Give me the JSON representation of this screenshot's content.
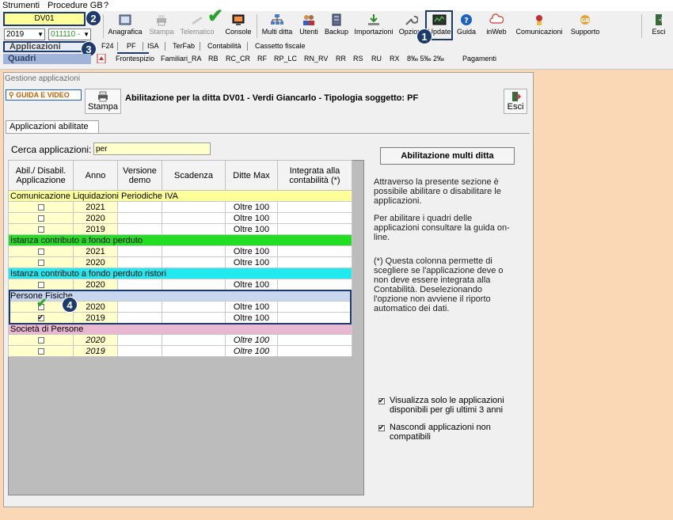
{
  "menubar": {
    "items": [
      "Strumenti",
      "Procedure GB",
      "?"
    ]
  },
  "context": {
    "firm": "DV01",
    "year": "2019",
    "code": "011110 -"
  },
  "callouts": [
    "1",
    "2",
    "3",
    "4"
  ],
  "toolbar": {
    "buttons": [
      {
        "label": "Anagrafica",
        "icon": "notebook-icon"
      },
      {
        "label": "Stampa",
        "icon": "printer-icon"
      },
      {
        "label": "Telematico",
        "icon": "telematico-icon"
      },
      {
        "label": "Console",
        "icon": "console-icon"
      },
      {
        "label": "Multi ditta",
        "icon": "org-chart-icon"
      },
      {
        "label": "Utenti",
        "icon": "users-icon"
      },
      {
        "label": "Backup",
        "icon": "server-icon"
      },
      {
        "label": "Importazioni",
        "icon": "download-icon"
      },
      {
        "label": "Opzioni",
        "icon": "wrench-icon"
      },
      {
        "label": "Update",
        "icon": "update-icon"
      },
      {
        "label": "Guida",
        "icon": "help-icon"
      },
      {
        "label": "inWeb",
        "icon": "cloud-icon"
      },
      {
        "label": "Comunicazioni",
        "icon": "megaphone-icon"
      },
      {
        "label": "Supporto",
        "icon": "support-icon"
      },
      {
        "label": "Esci",
        "icon": "exit-icon"
      }
    ]
  },
  "nav": {
    "applicazioni": "Applicazioni",
    "quadri": "Quadri",
    "tabs1": [
      "F24",
      "PF",
      "ISA",
      "TerFab",
      "Contabilità",
      "Cassetto fiscale"
    ],
    "tabs2": [
      "Frontespizio",
      "Familiari_RA",
      "RB",
      "RC_CR",
      "RF",
      "RP_LC",
      "RN_RV",
      "RR",
      "RS",
      "RU",
      "RX",
      "8‰ 5‰ 2‰",
      "Pagamenti"
    ]
  },
  "window": {
    "title": "Gestione applicazioni",
    "guida_video": "GUIDA E VIDEO",
    "stampa": "Stampa",
    "header": "Abilitazione per la ditta DV01 -  Verdi Giancarlo - Tipologia soggetto: PF",
    "esci": "Esci",
    "tab": "Applicazioni abilitate",
    "search_label": "Cerca applicazioni:",
    "search_value": "per"
  },
  "table": {
    "headers": [
      "Abil./ Disabil. Applicazione",
      "Anno",
      "Versione demo",
      "Scadenza",
      "Ditte Max",
      "Integrata alla contabilità (*)"
    ],
    "groups": [
      {
        "name": "Comunicazione Liquidazioni Periodiche IVA",
        "color": "#ffff99",
        "rows": [
          {
            "anno": "2021",
            "ditte": "Oltre 100",
            "on": false
          },
          {
            "anno": "2020",
            "ditte": "Oltre 100",
            "on": false
          },
          {
            "anno": "2019",
            "ditte": "Oltre 100",
            "on": false
          }
        ]
      },
      {
        "name": "Istanza contributo a fondo perduto",
        "color": "#22dd22",
        "rows": [
          {
            "anno": "2021",
            "ditte": "Oltre 100",
            "on": false
          },
          {
            "anno": "2020",
            "ditte": "Oltre 100",
            "on": false
          }
        ]
      },
      {
        "name": "Istanza contributo a fondo perduto ristori",
        "color": "#22e8f0",
        "rows": [
          {
            "anno": "2020",
            "ditte": "Oltre 100",
            "on": false
          }
        ]
      },
      {
        "name": "Persone Fisiche",
        "color": "#c8d6f0",
        "rows": [
          {
            "anno": "2020",
            "ditte": "Oltre 100",
            "on": false
          },
          {
            "anno": "2019",
            "ditte": "Oltre 100",
            "on": true
          }
        ]
      },
      {
        "name": "Società di Persone",
        "color": "#e8b8d0",
        "italic": true,
        "rows": [
          {
            "anno": "2020",
            "ditte": "Oltre 100",
            "on": false
          },
          {
            "anno": "2019",
            "ditte": "Oltre 100",
            "on": false
          }
        ]
      }
    ]
  },
  "right": {
    "multi_button": "Abilitazione multi ditta",
    "info1": "Attraverso la presente sezione è possibile abilitare o disabilitare le applicazioni.",
    "info2": "Per abilitare i quadri delle applicazioni consultare la guida on-line.",
    "info3": "(*) Questa colonna permette di scegliere se l'applicazione deve o non deve essere integrata alla Contabilità. Deselezionando l'opzione non avviene il riporto automatico dei dati.",
    "opt1": "Visualizza solo le applicazioni disponibili per gli ultimi 3 anni",
    "opt2": "Nascondi applicazioni non compatibili"
  },
  "colors": {
    "accent": "#1d3a6e",
    "check": "#27a52b",
    "background": "#fad8b6"
  }
}
